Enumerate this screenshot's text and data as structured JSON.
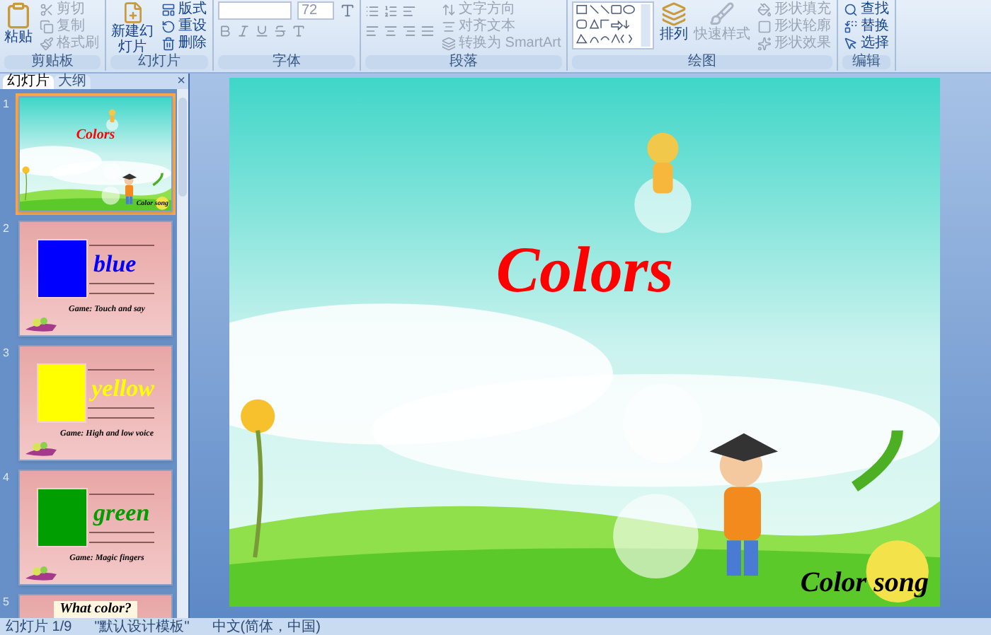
{
  "ribbon": {
    "groups": [
      {
        "kind": "clipboard",
        "label": "剪贴板",
        "big": "粘贴",
        "items": [
          {
            "label": "剪切",
            "disabled": true
          },
          {
            "label": "复制",
            "disabled": true
          },
          {
            "label": "格式刷",
            "disabled": true
          }
        ]
      },
      {
        "kind": "slides",
        "label": "幻灯片",
        "big": "新建幻灯片",
        "items": [
          {
            "label": "版式",
            "disabled": false
          },
          {
            "label": "重设",
            "disabled": false
          },
          {
            "label": "删除",
            "disabled": false
          }
        ]
      },
      {
        "kind": "font",
        "label": "字体",
        "font_size": "72"
      },
      {
        "kind": "paragraph",
        "label": "段落",
        "items": [
          {
            "label": "文字方向",
            "disabled": true
          },
          {
            "label": "对齐文本",
            "disabled": true
          },
          {
            "label": "转换为 SmartArt",
            "disabled": true
          }
        ]
      },
      {
        "kind": "drawing",
        "label": "绘图",
        "big": "排列",
        "big2": "快速样式",
        "items": [
          {
            "label": "形状填充",
            "disabled": true
          },
          {
            "label": "形状轮廓",
            "disabled": true
          },
          {
            "label": "形状效果",
            "disabled": true
          }
        ]
      },
      {
        "kind": "editing",
        "label": "编辑",
        "items": [
          {
            "label": "查找",
            "disabled": false
          },
          {
            "label": "替换",
            "disabled": false
          },
          {
            "label": "选择",
            "disabled": false
          }
        ]
      }
    ]
  },
  "pane": {
    "tabs": [
      {
        "label": "幻灯片",
        "selected": true
      },
      {
        "label": "大纲",
        "selected": false
      }
    ],
    "close": "×"
  },
  "thumbnails": [
    {
      "number": "1",
      "kind": "title",
      "selected": true,
      "title": "Colors",
      "subtitle": "Color song"
    },
    {
      "number": "2",
      "kind": "color",
      "selected": false,
      "word": "blue",
      "color": "#0000ff",
      "caption": "Game: Touch and say"
    },
    {
      "number": "3",
      "kind": "color",
      "selected": false,
      "word": "yellow",
      "color": "#ffff00",
      "caption": "Game: High and low voice"
    },
    {
      "number": "4",
      "kind": "color",
      "selected": false,
      "word": "green",
      "color": "#009e00",
      "caption": "Game: Magic fingers"
    },
    {
      "number": "5",
      "kind": "question",
      "selected": false,
      "title": "What color?"
    }
  ],
  "slide": {
    "title": "Colors",
    "subtitle": "Color song"
  },
  "status_bar": [
    "幻灯片 1/9",
    "\"默认设计模板\"",
    "中文(简体，中国)"
  ]
}
